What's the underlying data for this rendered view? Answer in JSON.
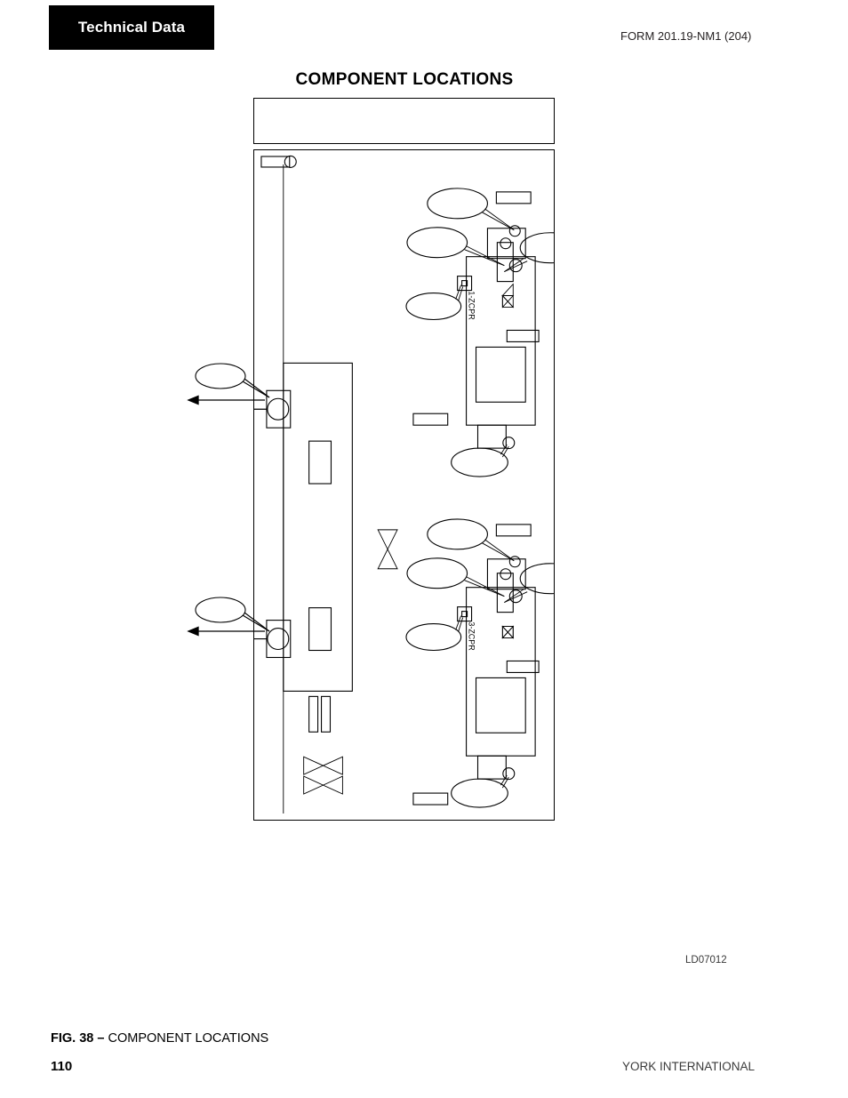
{
  "header": {
    "section_banner": "Technical Data",
    "form_number": "FORM 201.19-NM1 (204)"
  },
  "figure": {
    "title": "COMPONENT LOCATIONS",
    "drawing_number": "LD07012",
    "caption_prefix": "FIG. 38 – ",
    "caption_text": "COMPONENT LOCATIONS",
    "legend_box_text": ""
  },
  "diagram": {
    "labels": {
      "compressor_1": "1-ZCPR",
      "compressor_2": "3-ZCPR"
    },
    "callouts": [
      {
        "id": "callout-top-left-unit1",
        "text": ""
      },
      {
        "id": "callout-mid-left-unit1",
        "text": ""
      },
      {
        "id": "callout-right-unit1",
        "text": ""
      },
      {
        "id": "callout-switch-unit1",
        "text": ""
      },
      {
        "id": "callout-bottom-unit1",
        "text": ""
      },
      {
        "id": "callout-top-left-unit2",
        "text": ""
      },
      {
        "id": "callout-mid-left-unit2",
        "text": ""
      },
      {
        "id": "callout-right-unit2",
        "text": ""
      },
      {
        "id": "callout-switch-unit2",
        "text": ""
      },
      {
        "id": "callout-bottom-unit2",
        "text": ""
      },
      {
        "id": "callout-evaporator-upper",
        "text": ""
      },
      {
        "id": "callout-evaporator-lower",
        "text": ""
      }
    ],
    "blank_tags": [
      {
        "id": "tag-unit1-top",
        "text": ""
      },
      {
        "id": "tag-unit1-mid",
        "text": ""
      },
      {
        "id": "tag-unit1-left",
        "text": ""
      },
      {
        "id": "tag-unit2-top",
        "text": ""
      },
      {
        "id": "tag-unit2-mid",
        "text": ""
      },
      {
        "id": "tag-unit2-left",
        "text": ""
      },
      {
        "id": "tag-frame-corner",
        "text": ""
      }
    ]
  },
  "footer": {
    "page_number": "110",
    "company": "YORK INTERNATIONAL"
  },
  "colors": {
    "ink": "#000000",
    "banner_bg": "#000000",
    "banner_text": "#ffffff",
    "muted_text": "#3a3a3a"
  }
}
